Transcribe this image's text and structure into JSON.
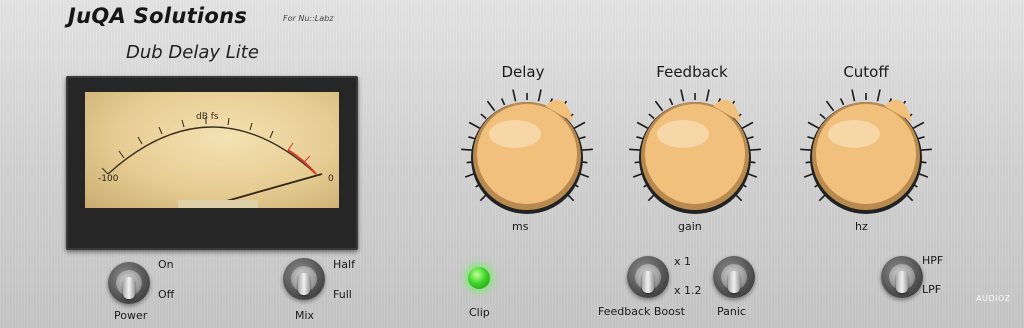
{
  "header": {
    "brand": "JuQA Solutions",
    "brand_sub": "For Nu::Labz",
    "product": "Dub Delay Lite"
  },
  "meter": {
    "unit_label": "dB fs",
    "min_label": "-100",
    "max_label": "0"
  },
  "knobs": {
    "delay": {
      "title": "Delay",
      "unit": "ms"
    },
    "feedback": {
      "title": "Feedback",
      "unit": "gain"
    },
    "cutoff": {
      "title": "Cutoff",
      "unit": "hz"
    }
  },
  "switches": {
    "power": {
      "label": "Power",
      "up": "On",
      "down": "Off"
    },
    "mix": {
      "label": "Mix",
      "up": "Half",
      "down": "Full"
    },
    "feedback_boost": {
      "label": "Feedback Boost",
      "up": "x 1",
      "down": "x 1.2"
    },
    "panic": {
      "label": "Panic"
    },
    "filter": {
      "up": "HPF",
      "down": "LPF"
    }
  },
  "clip": {
    "label": "Clip"
  },
  "watermark": "AUDIOZ",
  "colors": {
    "panel": "#d4d4d4",
    "knob_cap": "#f0c07c",
    "meter_face": "#ecd6a0",
    "meter_red": "#d83a2a",
    "led_green": "#3ed62a"
  }
}
